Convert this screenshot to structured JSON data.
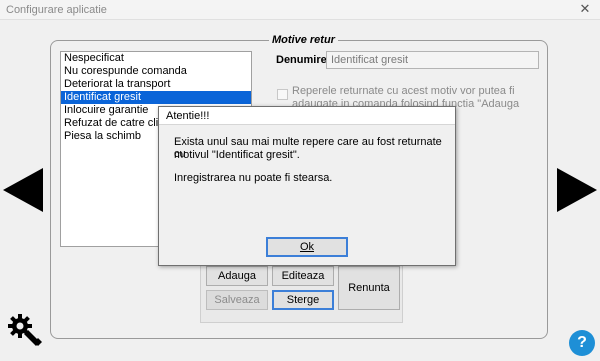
{
  "window": {
    "title": "Configurare aplicatie",
    "close_glyph": "✕"
  },
  "panel": {
    "legend": "Motive retur",
    "list_items": [
      "Nespecificat",
      "Nu corespunde comanda",
      "Deteriorat la transport",
      "Identificat gresit",
      "Inlocuire garantie",
      "Refuzat de catre client",
      "Piesa la schimb"
    ],
    "selected_index": 3,
    "denumire_label": "Denumire:",
    "denumire_value": "Identificat gresit",
    "checkbox_text": "Reperele returnate cu acest motiv vor putea fi adaugate in comanda folosind functia \"Adauga repere din istoric\".",
    "checkbox_checked": false,
    "buttons": {
      "adauga": "Adauga",
      "editeaza": "Editeaza",
      "salveaza": "Salveaza",
      "sterge": "Sterge",
      "renunta": "Renunta"
    }
  },
  "navigation": {
    "prev_icon": "arrow-left-icon",
    "next_icon": "arrow-right-icon",
    "help_label": "?",
    "settings_icon": "gear-icon"
  },
  "dialog": {
    "title": "Atentie!!!",
    "message_line1": "Exista unul sau mai multe repere care au fost returnate cu",
    "message_line2": "motivul \"Identificat gresit\".",
    "message_line3": "Inregistrarea nu poate fi stearsa.",
    "ok_label": "Ok"
  },
  "colors": {
    "selection": "#0a64d8",
    "default_button_border": "#3c7fd8",
    "help_button": "#1e8fd6"
  }
}
